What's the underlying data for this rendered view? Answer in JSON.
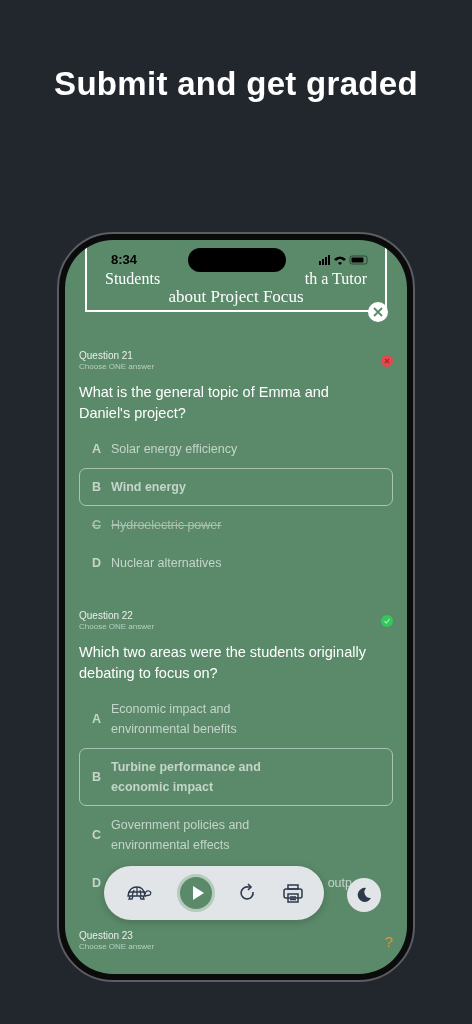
{
  "headline": "Submit and get graded",
  "status_bar": {
    "time": "8:34"
  },
  "passage_title": {
    "fragments": [
      "Students",
      "th a Tutor"
    ],
    "line_2": "about Project Focus"
  },
  "questions": [
    {
      "number": "Question 21",
      "instruction": "Choose ONE answer",
      "kind": "wrong",
      "text": "What is the general topic of Emma and Daniel's project?",
      "options": [
        {
          "letter": "A",
          "text": "Solar energy efficiency",
          "selected": false,
          "struck": false
        },
        {
          "letter": "B",
          "text": "Wind energy",
          "selected": true,
          "struck": false
        },
        {
          "letter": "C",
          "text": "Hydroelectric power",
          "selected": false,
          "struck": true
        },
        {
          "letter": "D",
          "text": "Nuclear alternatives",
          "selected": false,
          "struck": false
        }
      ]
    },
    {
      "number": "Question 22",
      "instruction": "Choose ONE answer",
      "kind": "correct",
      "text": "Which two areas were the students originally debating to focus on?",
      "options": [
        {
          "letter": "A",
          "text": "Economic impact and environmental benefits",
          "selected": false,
          "struck": false
        },
        {
          "letter": "B",
          "text": "Turbine performance and economic impact",
          "selected": true,
          "struck": false
        },
        {
          "letter": "C",
          "text": "Government policies and environmental effects",
          "selected": false,
          "struck": false
        },
        {
          "letter": "D",
          "text": "outp",
          "hidden_start": true
        }
      ]
    },
    {
      "number": "Question 23",
      "instruction": "Choose ONE answer",
      "kind": "unanswered",
      "status_text": "?"
    }
  ]
}
